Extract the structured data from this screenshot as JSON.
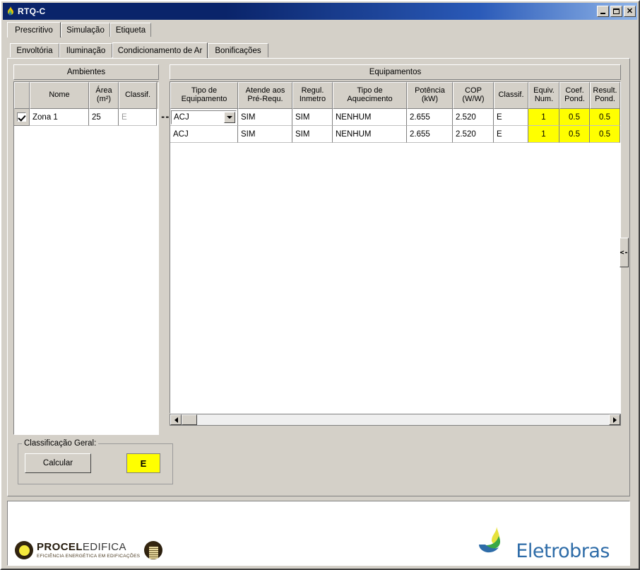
{
  "window": {
    "title": "RTQ-C",
    "icon": "flame-icon",
    "buttons": {
      "minimize": "minimize-button",
      "maximize": "maximize-button",
      "close": "close-button"
    }
  },
  "tabs_outer": [
    {
      "label": "Prescritivo",
      "active": true
    },
    {
      "label": "Simulação",
      "active": false
    },
    {
      "label": "Etiqueta",
      "active": false
    }
  ],
  "tabs_inner": [
    {
      "label": "Envoltória",
      "active": false
    },
    {
      "label": "Iluminação",
      "active": false
    },
    {
      "label": "Condicionamento de Ar",
      "active": true
    },
    {
      "label": "Bonificações",
      "active": false
    }
  ],
  "ambientes": {
    "header": "Ambientes",
    "columns": [
      "",
      "Nome",
      "Área\n(m²)",
      "Classif."
    ],
    "columns_flat": [
      "",
      "Nome",
      "Área (m²)",
      "Classif."
    ],
    "col_area_line1": "Área",
    "col_area_line2": "(m²)",
    "rows": [
      {
        "checked": true,
        "nome": "Zona 1",
        "area": "25",
        "classif": "E"
      }
    ]
  },
  "equipamentos": {
    "header": "Equipamentos",
    "columns": [
      {
        "line1": "Tipo de",
        "line2": "Equipamento"
      },
      {
        "line1": "Atende aos",
        "line2": "Pré-Requ."
      },
      {
        "line1": "Regul.",
        "line2": "Inmetro"
      },
      {
        "line1": "Tipo de",
        "line2": "Aquecimento"
      },
      {
        "line1": "Potência",
        "line2": "(kW)"
      },
      {
        "line1": "COP",
        "line2": "(W/W)"
      },
      {
        "line1": "Classif.",
        "line2": ""
      },
      {
        "line1": "Equiv.",
        "line2": "Num."
      },
      {
        "line1": "Coef.",
        "line2": "Pond."
      },
      {
        "line1": "Result.",
        "line2": "Pond."
      }
    ],
    "rows": [
      {
        "tipo_equipamento": "ACJ",
        "atende_pre_requisitos": "SIM",
        "regul_inmetro": "SIM",
        "tipo_aquecimento": "NENHUM",
        "potencia_kw": "2.655",
        "cop_ww": "2.520",
        "classif": "E",
        "equiv_num": "1",
        "coef_pond": "0.5",
        "result_pond": "0.5",
        "selected": true
      },
      {
        "tipo_equipamento": "ACJ",
        "atende_pre_requisitos": "SIM",
        "regul_inmetro": "SIM",
        "tipo_aquecimento": "NENHUM",
        "potencia_kw": "2.655",
        "cop_ww": "2.520",
        "classif": "E",
        "equiv_num": "1",
        "coef_pond": "0.5",
        "result_pond": "0.5",
        "selected": false
      }
    ],
    "row_pointer": "-->",
    "collapse_handle": "<-"
  },
  "classificacao": {
    "legend": "Classificação Geral:",
    "button_label": "Calcular",
    "result": "E",
    "result_color": "#ffff00"
  },
  "footer": {
    "procel": {
      "bold": "PROCEL",
      "light": "EDIFICA",
      "tagline": "EFICIÊNCIA ENERGÉTICA EM EDIFICAÇÕES"
    },
    "eletrobras": {
      "name": "Eletrobras"
    }
  },
  "colors": {
    "window_face": "#d4d0c8",
    "title_start": "#0a246a",
    "title_end": "#8fb4e8",
    "highlight_yellow": "#ffff00",
    "grid_line": "#808080",
    "eletrobras_blue": "#2e6ca8"
  }
}
